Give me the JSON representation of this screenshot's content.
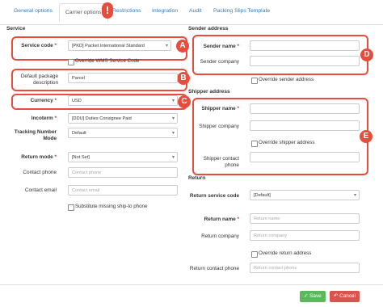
{
  "tabs": [
    "General options",
    "Carrier options",
    "Restrictions",
    "Integration",
    "Audit",
    "Packing Slips Template"
  ],
  "markers": {
    "tab": "!",
    "a": "A",
    "b": "B",
    "c": "C",
    "d": "D",
    "e": "E"
  },
  "service": {
    "title": "Service",
    "service_code_label": "Service code",
    "service_code_value": "[PKD] Packet International Standard",
    "override_wms_label": "Override WMS Service Code",
    "default_package_desc_label": "Default package description",
    "default_package_desc_value": "Parcel",
    "currency_label": "Currency",
    "currency_value": "USD",
    "incoterm_label": "Incoterm",
    "incoterm_value": "[DDU] Duties Consignee Paid",
    "tracking_label": "Tracking Number Mode",
    "tracking_value": "Default",
    "return_mode_label": "Return mode",
    "return_mode_value": "[Not Set]",
    "contact_phone_label": "Contact phone",
    "contact_phone_placeholder": "Contact phone",
    "contact_email_label": "Contact email",
    "contact_email_placeholder": "Contact email",
    "substitute_label": "Substitute missing ship-to phone"
  },
  "sender": {
    "title": "Sender address",
    "name_label": "Sender name",
    "company_label": "Sender company",
    "override_label": "Override sender address"
  },
  "shipper": {
    "title": "Shipper address",
    "name_label": "Shipper name",
    "company_label": "Shipper company",
    "override_label": "Override shipper address",
    "contact_phone_label": "Shipper contact phone"
  },
  "return": {
    "title": "Return",
    "service_code_label": "Return service code",
    "service_code_value": "[Default]",
    "name_label": "Return name",
    "name_placeholder": "Return name",
    "company_label": "Return company",
    "company_placeholder": "Return company",
    "override_label": "Override return address",
    "contact_phone_label": "Return contact phone",
    "contact_phone_placeholder": "Return contact phone"
  },
  "buttons": {
    "save": "Save",
    "cancel": "Cancel"
  },
  "colors": {
    "marker": "#e74c3c",
    "save": "#5cb85c",
    "cancel": "#d9534f",
    "link": "#337ab7"
  }
}
